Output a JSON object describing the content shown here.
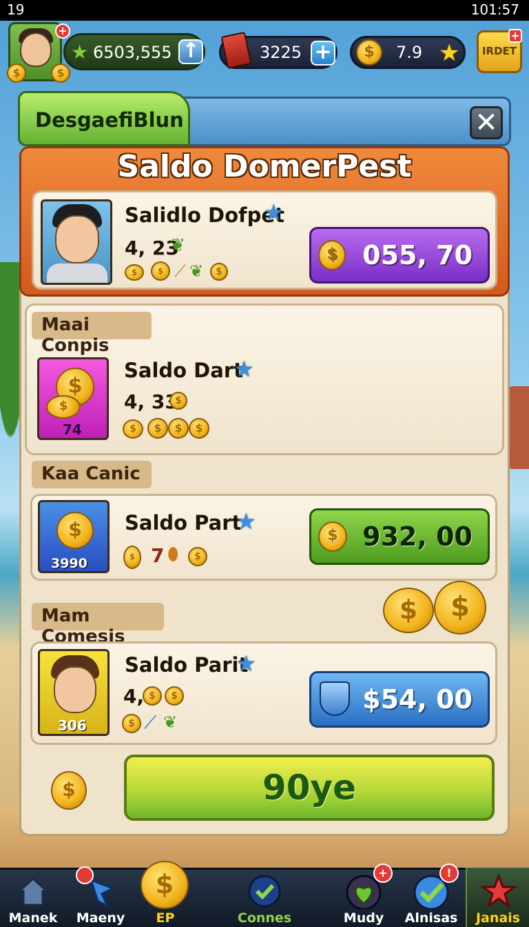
{
  "status_bar": {
    "left": "19",
    "time": "101:57"
  },
  "top_bar": {
    "xp": "6503,555",
    "books": "3225",
    "coins": "7.9",
    "shop_label": "IRDET"
  },
  "dialog": {
    "tab_title": "DesgaefiBlun",
    "close_symbol": "✕",
    "banner_title": "Saldo DomerPest",
    "featured": {
      "name": "Salidlo Dofpet",
      "amount": "4, 23",
      "price": "055, 70",
      "price_color": "#8a3fd6"
    },
    "sections": [
      {
        "category": "Maai Conpis",
        "name": "Saldo Dart",
        "amount": "4, 33",
        "thumb_label": "74"
      },
      {
        "category": "Kaa Canic",
        "name": "Saldo Part",
        "amount": "7",
        "thumb_label": "3990",
        "price": "932, 00"
      },
      {
        "category": "Mam Comesis",
        "name": "Saldo Parit",
        "amount": "4,",
        "thumb_label": "306",
        "price": "$54, 00"
      }
    ],
    "main_button": "90ye"
  },
  "bottom_nav": [
    {
      "label": "Manek",
      "icon": "home-icon"
    },
    {
      "label": "Maeny",
      "icon": "flag-icon"
    },
    {
      "label": "EP",
      "icon": "coin-icon"
    },
    {
      "label": "Connes",
      "icon": "check-shield-icon"
    },
    {
      "label": "Mudy",
      "icon": "heart-check-icon"
    },
    {
      "label": "Alnisas",
      "icon": "check-icon"
    },
    {
      "label": "Janais",
      "icon": "star-icon"
    }
  ],
  "colors": {
    "accent_orange": "#e2712d",
    "accent_green": "#63b233",
    "accent_purple": "#8a3fd6",
    "accent_blue": "#2a6fc4"
  }
}
